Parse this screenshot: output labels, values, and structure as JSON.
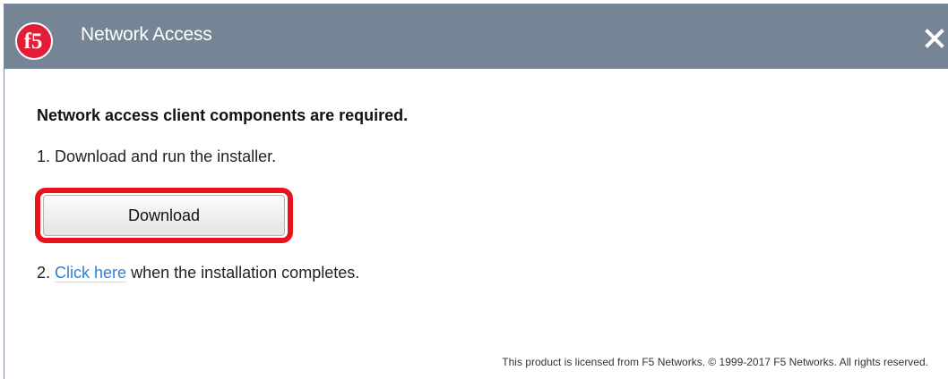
{
  "window": {
    "title": "Network Access",
    "logo_text": "f5",
    "close_icon": "close-icon",
    "titlebar_color": "#758595"
  },
  "content": {
    "heading": "Network access client components are required.",
    "step1": "1. Download and run the installer.",
    "download_button": "Download",
    "step2_prefix": "2.",
    "step2_link": "Click here",
    "step2_suffix": "when the installation completes.",
    "highlight_color": "#e8141b",
    "link_color": "#2f7fd3"
  },
  "footer": {
    "text": "This product is licensed from F5 Networks. © 1999-2017 F5 Networks. All rights reserved."
  }
}
